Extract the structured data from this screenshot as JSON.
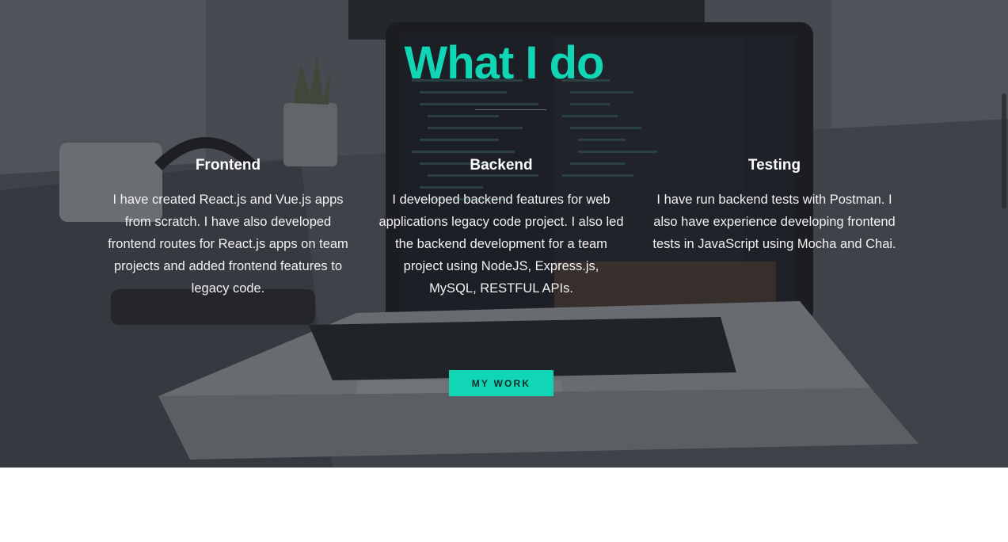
{
  "colors": {
    "accent": "#10d6b6",
    "text": "#ffffff",
    "button_text": "#1c2a2a"
  },
  "hero": {
    "background": "laptop-on-desk-photo",
    "title": "What I do"
  },
  "services": [
    {
      "heading": "Frontend",
      "body": "I have created React.js and Vue.js apps from scratch. I have also developed frontend routes for React.js apps on team projects and added frontend features to legacy code."
    },
    {
      "heading": "Backend",
      "body": "I developed backend features for web applications legacy code project. I also led the backend development for a team project using NodeJS, Express.js, MySQL, RESTFUL APIs."
    },
    {
      "heading": "Testing",
      "body": "I have run backend tests with Postman. I also have experience developing frontend tests in JavaScript using Mocha and Chai."
    }
  ],
  "cta": {
    "label": "MY WORK"
  }
}
